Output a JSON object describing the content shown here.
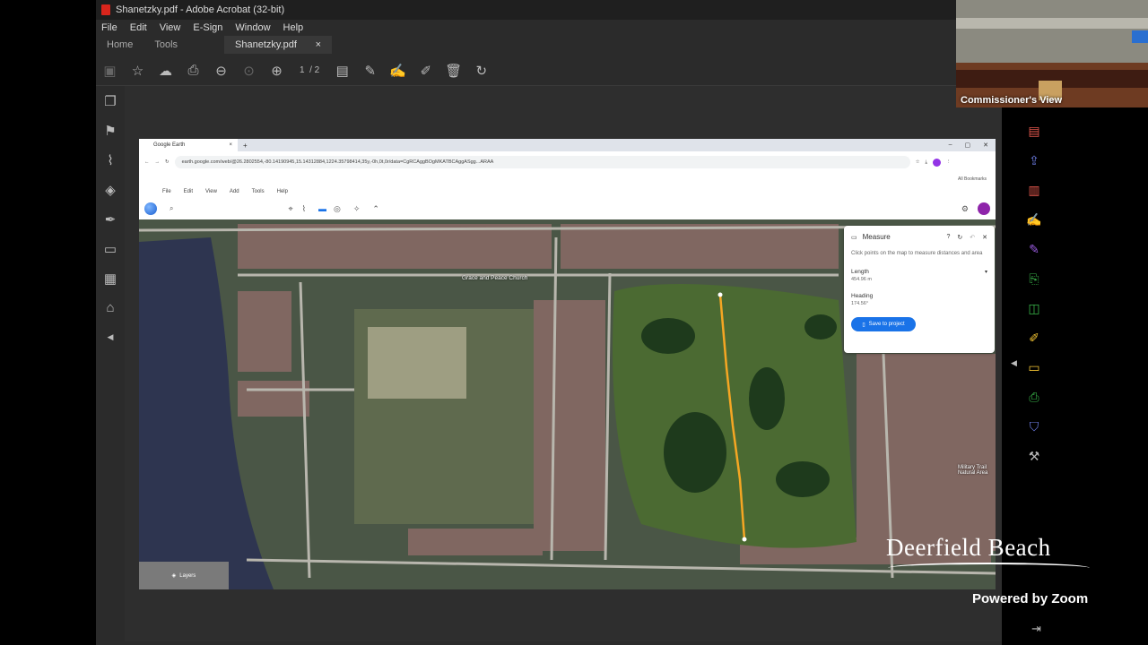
{
  "acrobat": {
    "window_title": "Shanetzky.pdf - Adobe Acrobat (32-bit)",
    "menu": [
      "File",
      "Edit",
      "View",
      "E-Sign",
      "Window",
      "Help"
    ],
    "tabs": {
      "home": "Home",
      "tools": "Tools",
      "document": "Shanetzky.pdf",
      "close": "×"
    },
    "page_current": "1",
    "page_total": "/ 2"
  },
  "browser": {
    "tab_title": "Google Earth",
    "new_tab": "+",
    "url": "earth.google.com/web/@26.2802554,-80.14190945,15.14312884,1224.35798414,35y,-0h,0t,0r/data=CgRCAggBOgMKATBCAggASgg...ARAA",
    "bookmarks": "All Bookmarks"
  },
  "google_earth": {
    "menu": [
      "File",
      "Edit",
      "View",
      "Add",
      "Tools",
      "Help"
    ],
    "map_labels": {
      "church": "Grace and Peace Church",
      "military_trail": "Military Trail\nNatural Area",
      "layers": "Layers"
    },
    "measure": {
      "title": "Measure",
      "description": "Click points on the map to measure distances and area",
      "length_label": "Length",
      "length_value": "454.96 m",
      "heading_label": "Heading",
      "heading_value": "174.56°",
      "save_button": "Save to project"
    }
  },
  "zoom": {
    "camera_label": "Commissioner's View",
    "brand": "Deerfield Beach",
    "powered_by": "Powered by Zoom"
  },
  "colors": {
    "measure_line": "#f5a623",
    "save_button": "#1a73e8",
    "acrobat_bg": "#2b2b2b"
  }
}
